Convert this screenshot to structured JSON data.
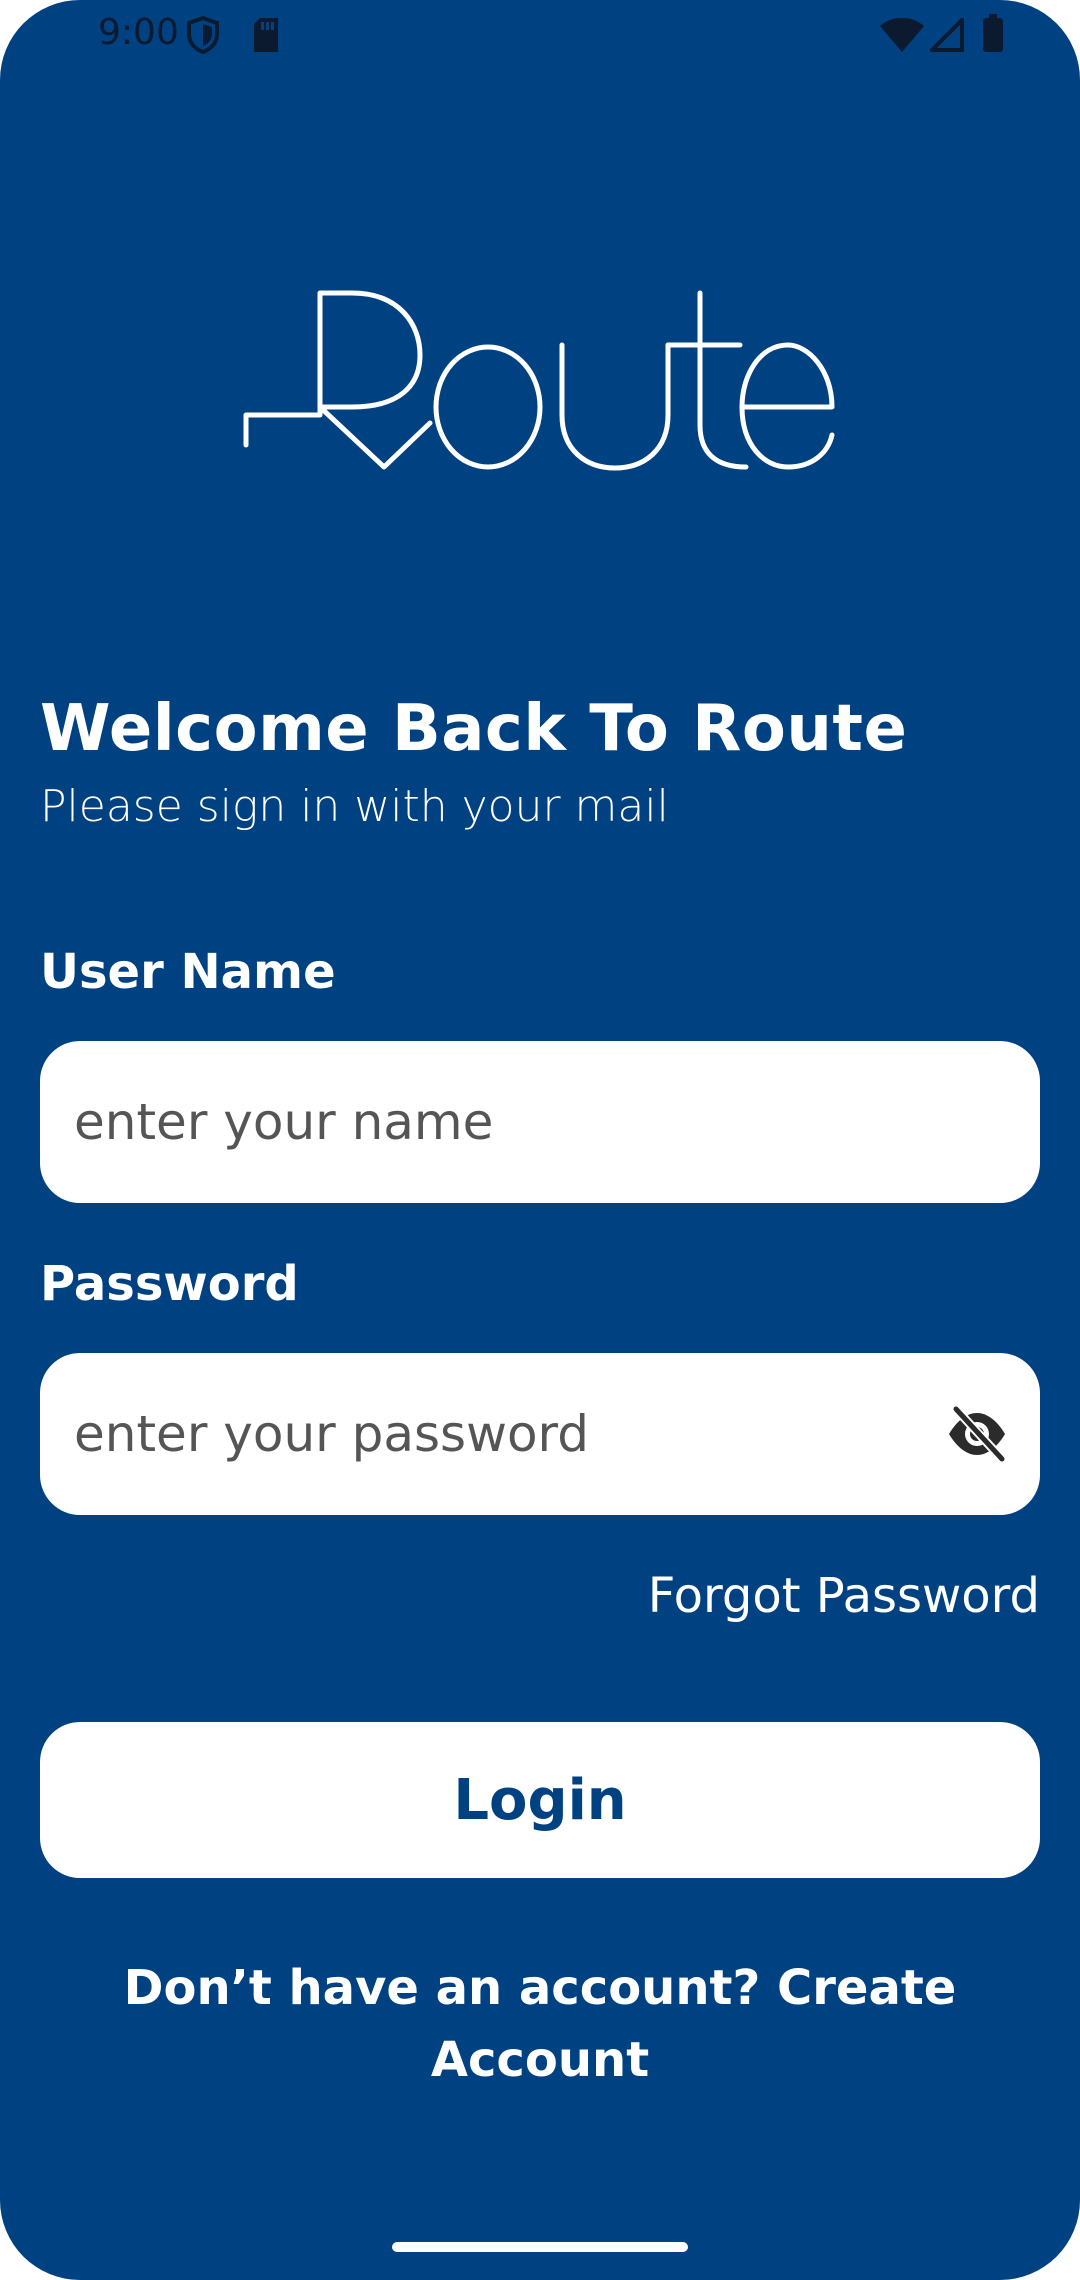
{
  "status_bar": {
    "time": "9:00",
    "icons": [
      "shield-icon",
      "sim-card-icon",
      "wifi-icon",
      "cellular-signal-icon",
      "battery-icon"
    ]
  },
  "logo": {
    "text": "Route",
    "icon": "route-logo"
  },
  "header": {
    "title": "Welcome Back To Route",
    "subtitle": "Please sign in with your mail"
  },
  "form": {
    "username": {
      "label": "User Name",
      "placeholder": "enter your name",
      "value": ""
    },
    "password": {
      "label": "Password",
      "placeholder": "enter your password",
      "value": "",
      "toggle_icon": "eye-off-icon"
    },
    "forgot_password": "Forgot Password",
    "login_button": "Login"
  },
  "footer": {
    "signup_prompt": "Don’t have an account? Create Account"
  },
  "colors": {
    "background": "#004182",
    "surface": "#FFFFFF",
    "accent_text": "#004182",
    "placeholder_text": "#555555"
  }
}
